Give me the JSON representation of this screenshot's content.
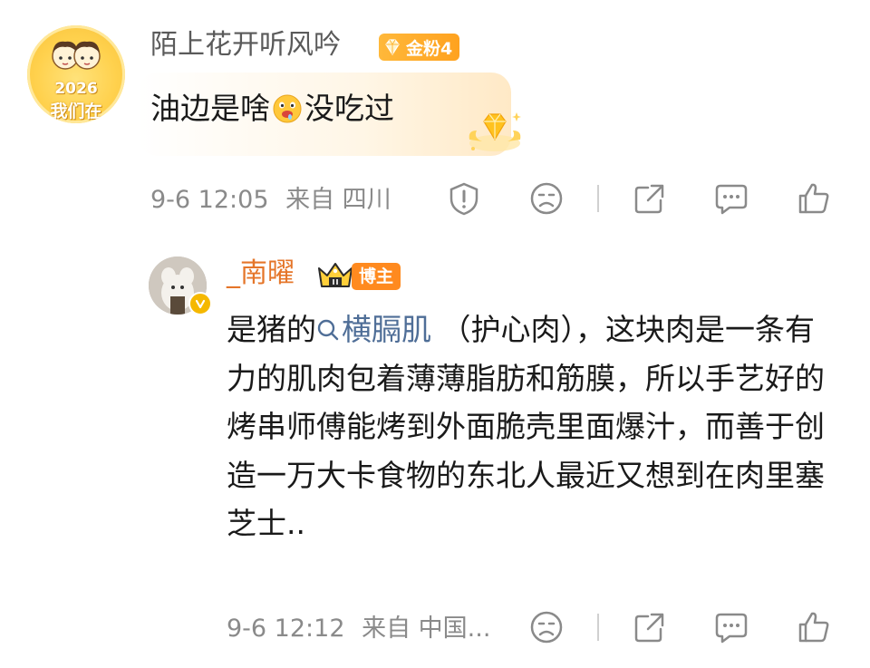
{
  "comment": {
    "avatar_text_year": "2026",
    "avatar_text_line": "我们在",
    "username": "陌上花开听风吟",
    "fan_badge": "金粉4",
    "text_before_emoji": "油边是啥",
    "text_after_emoji": "没吃过",
    "time": "9-6 12:05",
    "location": "来自 四川"
  },
  "reply": {
    "username": "_南曜",
    "role_badge": "博主",
    "text_prefix": "是猪的",
    "topic_link": "横膈肌",
    "text_rest": " （护心肉），这块肉是一条有力的肌肉包着薄薄脂肪和筋膜，所以手艺好的烤串师傅能烤到外面脆壳里面爆汁，而善于创造一万大卡食物的东北人最近又想到在肉里塞芝士..",
    "time": "9-6 12:12",
    "location": "来自 中国..."
  },
  "colors": {
    "username_gray": "#5a5a5a",
    "meta_gray": "#8a8a8a",
    "blogger_orange": "#e5762a",
    "badge_orange": "#ff8a1f",
    "link_blue": "#4f6e97"
  },
  "icons": {
    "comment_actions": [
      "report-icon",
      "dislike-icon",
      "share-icon",
      "reply-icon",
      "like-icon"
    ],
    "reply_actions": [
      "dislike-icon",
      "share-icon",
      "reply-icon",
      "like-icon"
    ]
  }
}
